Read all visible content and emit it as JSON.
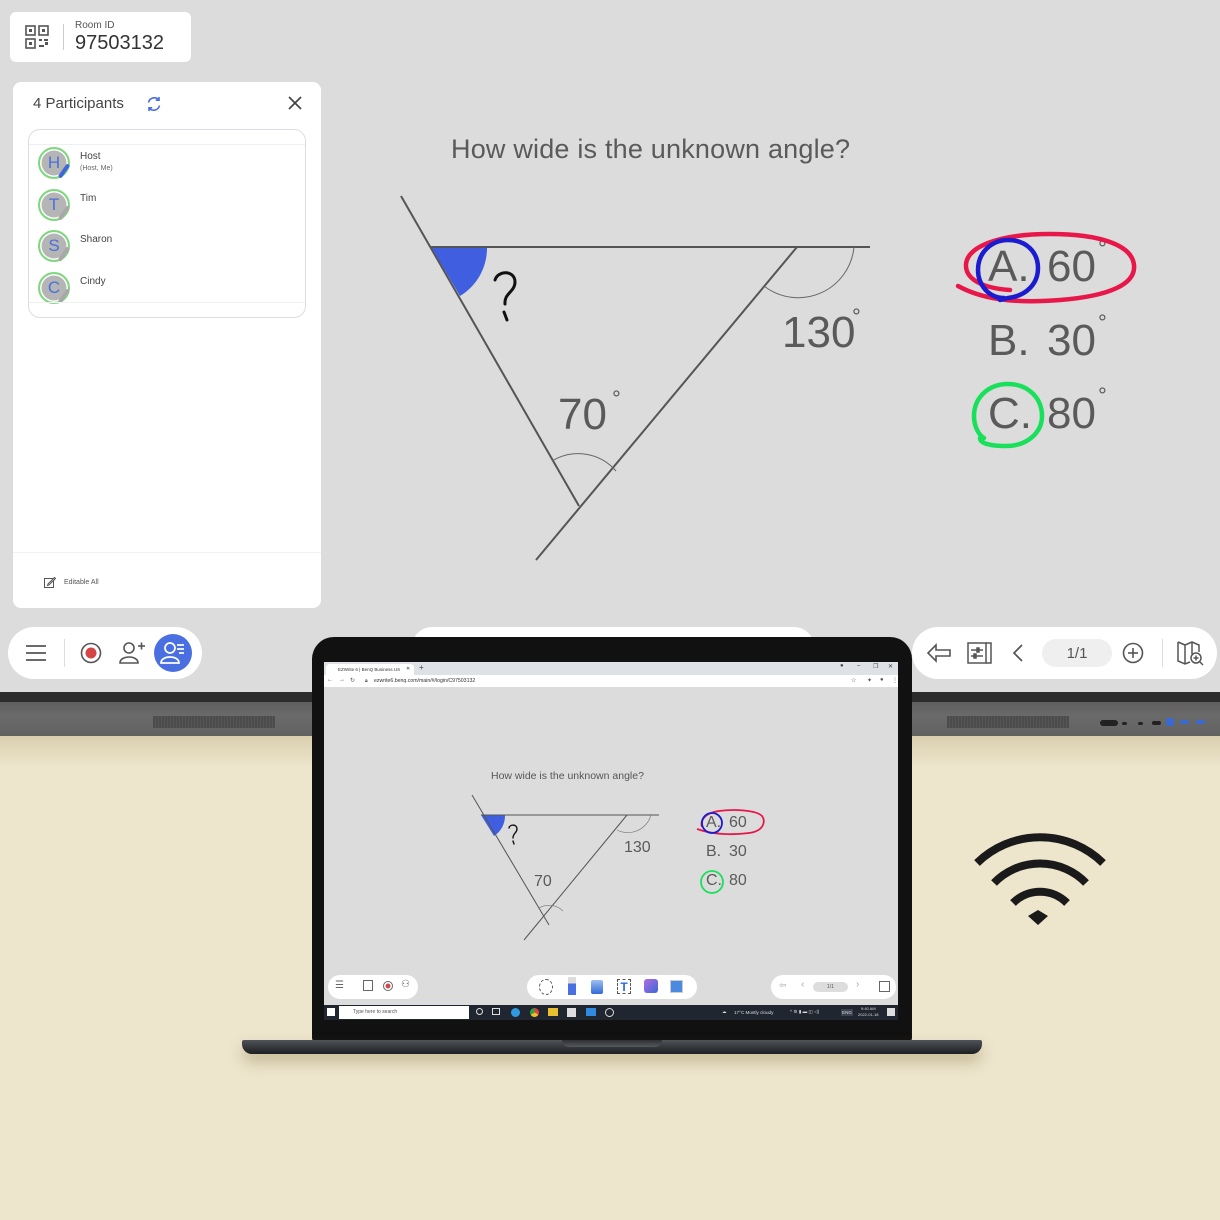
{
  "room": {
    "label": "Room ID",
    "id": "97503132",
    "qr_icon": "qr-code-icon"
  },
  "participants_panel": {
    "title": "4 Participants",
    "refresh_icon": "refresh-icon",
    "close_icon": "close-icon",
    "participants": [
      {
        "initial": "H",
        "name": "Host",
        "role": "(Host, Me)",
        "pen_color": "#3f66d8"
      },
      {
        "initial": "T",
        "name": "Tim",
        "role": "",
        "pen_color": "#a8a8a8"
      },
      {
        "initial": "S",
        "name": "Sharon",
        "role": "",
        "pen_color": "#a8a8a8"
      },
      {
        "initial": "C",
        "name": "Cindy",
        "role": "",
        "pen_color": "#a8a8a8"
      }
    ],
    "footer": {
      "label": "Editable All",
      "icon": "edit-icon"
    }
  },
  "whiteboard": {
    "question": "How wide is the unknown angle?",
    "unknown_mark": "?",
    "angle_labels": {
      "top_right": "130",
      "bottom": "70",
      "degree": "°"
    },
    "answers": [
      {
        "letter": "A.",
        "value": "60",
        "circled": "blue-and-red"
      },
      {
        "letter": "B.",
        "value": "30",
        "circled": "none"
      },
      {
        "letter": "C.",
        "value": "80",
        "circled": "green"
      }
    ],
    "colors": {
      "highlight_fill": "#3f5fe0",
      "ink_red": "#e8174a",
      "ink_blue": "#1b1bd0",
      "ink_green": "#19e05a",
      "line": "#555555"
    }
  },
  "toolbar_left": {
    "menu_icon": "hamburger-menu-icon",
    "record_icon": "record-icon",
    "invite_icon": "add-person-icon",
    "participants_icon": "participants-list-icon",
    "accent": "#4a6fe0"
  },
  "toolbar_right": {
    "undo_icon": "undo-icon",
    "settings_icon": "page-settings-icon",
    "prev_icon": "chevron-left-icon",
    "page": "1/1",
    "add_page_icon": "add-page-icon",
    "overview_icon": "page-overview-icon"
  },
  "laptop": {
    "browser": {
      "tab_title": "EZWrite 6 | BenQ Business US",
      "new_tab": "+",
      "url": "ezwrite6.benq.com/main/#/login/C97503132",
      "window_controls": [
        "–",
        "❐",
        "✕"
      ]
    },
    "whiteboard": {
      "question": "How wide is the unknown angle?",
      "answers": [
        {
          "letter": "A.",
          "value": "60"
        },
        {
          "letter": "B.",
          "value": "30"
        },
        {
          "letter": "C.",
          "value": "80"
        }
      ],
      "angle_labels": {
        "top_right": "130",
        "bottom": "70"
      }
    },
    "toolbar": {
      "page": "1/1",
      "tools": [
        "lasso-select",
        "pen",
        "eraser",
        "text",
        "shapes",
        "image"
      ]
    },
    "taskbar": {
      "search_placeholder": "Type here to search",
      "weather": "17°C  Mostly cloudy",
      "language": "ENG",
      "time": "9:40 AM",
      "date": "2022-01-18"
    }
  },
  "wifi_icon": "wifi-icon"
}
